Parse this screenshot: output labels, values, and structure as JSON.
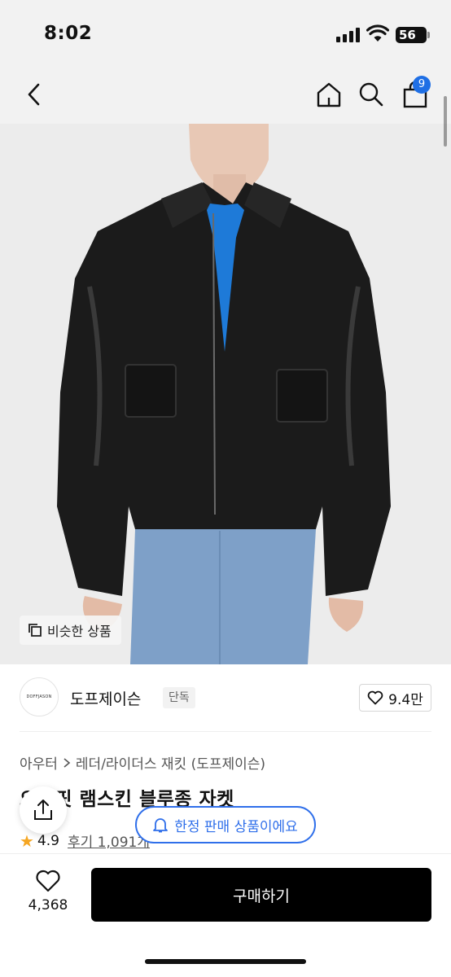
{
  "status_bar": {
    "time": "8:02",
    "battery": "56"
  },
  "nav": {
    "cart_count": "9"
  },
  "image": {
    "similar_label": "비슷한 상품"
  },
  "brand": {
    "logo_text": "DOFFJASON",
    "name": "도프제이슨",
    "tag": "단독",
    "likes": "9.4만"
  },
  "breadcrumb": {
    "category": "아우터",
    "subcategory": "레더/라이더스 재킷 (도프제이슨)"
  },
  "product": {
    "title": "오버핏 램스킨 블루종 자켓",
    "rating": "4.9",
    "reviews": "후기 1,091개"
  },
  "banner": {
    "text": "한정 판매 상품이에요"
  },
  "bottom": {
    "wish_count": "4,368",
    "buy_label": "구매하기"
  },
  "colors": {
    "accent": "#2f6fea",
    "badge": "#1f6fe5",
    "rating_star": "#f5a623",
    "buy_button": "#000000"
  }
}
